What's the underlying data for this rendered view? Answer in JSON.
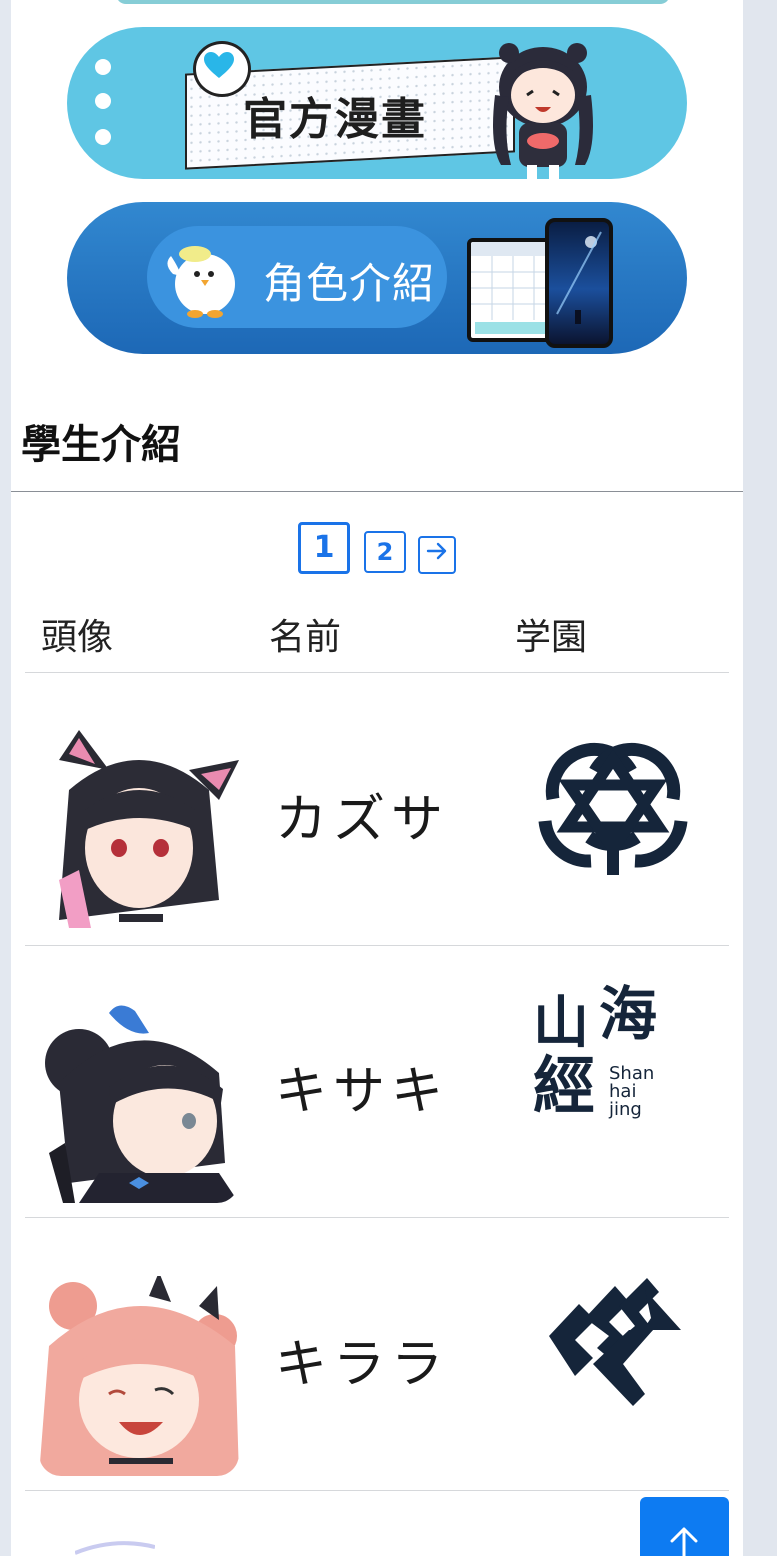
{
  "banners": {
    "manga": {
      "label": "官方漫畫"
    },
    "characters": {
      "label": "角色介紹"
    }
  },
  "section": {
    "title": "學生介紹"
  },
  "pagination": {
    "pages": [
      "1",
      "2"
    ],
    "current": "1",
    "next_icon": "arrow-right-icon"
  },
  "table": {
    "headers": [
      "頭像",
      "名前",
      "学園"
    ],
    "rows": [
      {
        "name": "カズサ",
        "school_logo": "trinity-emblem"
      },
      {
        "name": "キサキ",
        "school_logo": "shanhaijing-emblem",
        "logo_text": {
          "cn": [
            "山",
            "海",
            "經"
          ],
          "latin": [
            "Shan",
            "hai",
            "jing"
          ]
        }
      },
      {
        "name": "キララ",
        "school_logo": "gehenna-emblem"
      }
    ]
  },
  "colors": {
    "accent": "#1a73e8",
    "back_to_top": "#0d7bf2",
    "manga_banner": "#5fc6e4",
    "character_banner": "#2478c4",
    "emblem": "#15253a"
  },
  "back_to_top": {
    "icon": "arrow-up-icon"
  }
}
